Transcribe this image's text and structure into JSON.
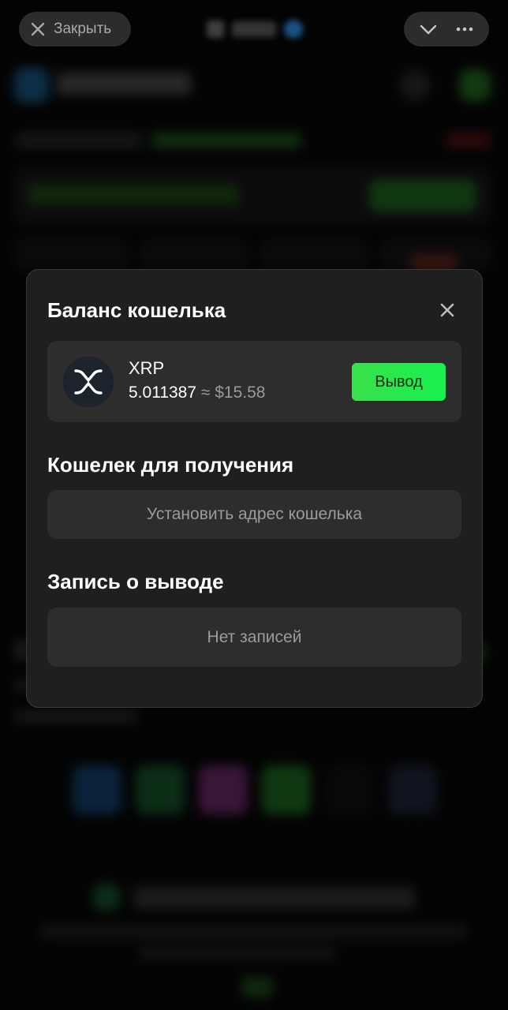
{
  "topbar": {
    "close_label": "Закрыть",
    "icons": [
      "close-icon",
      "chevron-down-icon",
      "more-icon"
    ]
  },
  "modal": {
    "title": "Баланс кошелька",
    "coin": {
      "symbol": "XRP",
      "amount": "5.011387",
      "approx": "≈ $15.58",
      "icon": "xrp-icon"
    },
    "withdraw_label": "Вывод",
    "receive_section_title": "Кошелек для получения",
    "set_address_label": "Установить адрес кошелька",
    "withdraw_record_title": "Запись о выводе",
    "no_records_label": "Нет записей"
  },
  "colors": {
    "accent_green": "#2ee84c",
    "modal_bg": "#1f1f1f",
    "card_bg": "#2d2d2d"
  }
}
